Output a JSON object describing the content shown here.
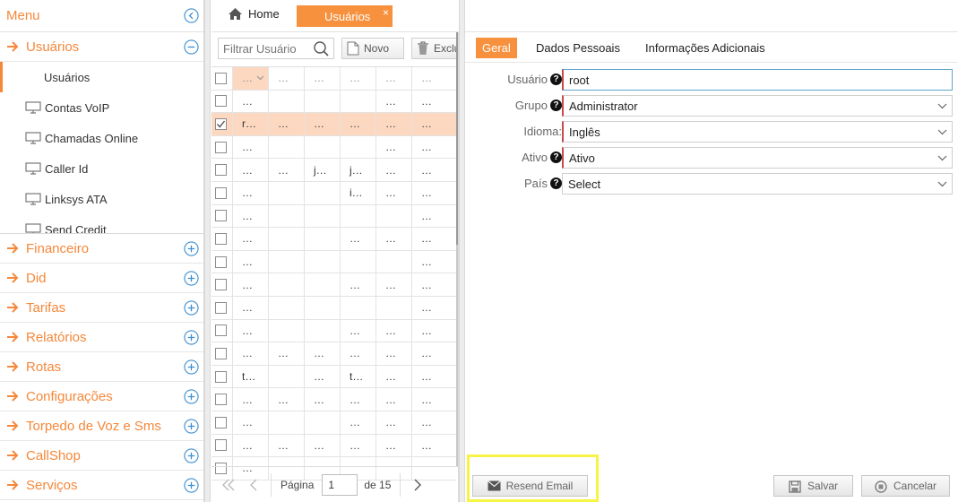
{
  "sidebar": {
    "title": "Menu",
    "sections": [
      {
        "label": "Usuários",
        "expanded": true
      },
      {
        "label": "Financeiro"
      },
      {
        "label": "Did"
      },
      {
        "label": "Tarifas"
      },
      {
        "label": "Relatórios"
      },
      {
        "label": "Rotas"
      },
      {
        "label": "Configurações"
      },
      {
        "label": "Torpedo de Voz e Sms"
      },
      {
        "label": "CallShop"
      },
      {
        "label": "Serviços"
      }
    ],
    "sub_items": [
      {
        "label": "Usuários",
        "active": true
      },
      {
        "label": "Contas VoIP"
      },
      {
        "label": "Chamadas Online"
      },
      {
        "label": "Caller Id"
      },
      {
        "label": "Linksys ATA"
      },
      {
        "label": "Send Credit"
      }
    ]
  },
  "tabs": {
    "home": "Home",
    "active": "Usuários",
    "close": "×"
  },
  "grid": {
    "filter_placeholder": "Filtrar Usuário",
    "new_label": "Novo",
    "delete_label": "Excluir",
    "header": [
      "…",
      "…",
      "…",
      "…",
      "…",
      "…"
    ],
    "rows": [
      {
        "checked": false,
        "cells": [
          "…",
          "",
          "",
          "",
          "…",
          "…"
        ]
      },
      {
        "checked": true,
        "cells": [
          "r…",
          "…",
          "…",
          "…",
          "…",
          "…"
        ]
      },
      {
        "checked": false,
        "cells": [
          "…",
          "",
          "",
          "",
          "…",
          "…"
        ]
      },
      {
        "checked": false,
        "cells": [
          "…",
          "…",
          "j…",
          "j…",
          "…",
          "…"
        ]
      },
      {
        "checked": false,
        "cells": [
          "…",
          "",
          "",
          "i…",
          "…",
          "…"
        ]
      },
      {
        "checked": false,
        "cells": [
          "…",
          "",
          "",
          "",
          "",
          "…"
        ]
      },
      {
        "checked": false,
        "cells": [
          "…",
          "",
          "",
          "…",
          "…",
          "…"
        ]
      },
      {
        "checked": false,
        "cells": [
          "…",
          "",
          "",
          "",
          "",
          "…"
        ]
      },
      {
        "checked": false,
        "cells": [
          "…",
          "",
          "",
          "…",
          "…",
          "…"
        ]
      },
      {
        "checked": false,
        "cells": [
          "…",
          "",
          "",
          "",
          "",
          "…"
        ]
      },
      {
        "checked": false,
        "cells": [
          "…",
          "",
          "",
          "…",
          "…",
          "…"
        ]
      },
      {
        "checked": false,
        "cells": [
          "…",
          "…",
          "…",
          "…",
          "…",
          "…"
        ]
      },
      {
        "checked": false,
        "cells": [
          "t…",
          "",
          "…",
          "t…",
          "…",
          "…"
        ]
      },
      {
        "checked": false,
        "cells": [
          "…",
          "…",
          "…",
          "…",
          "…",
          "…"
        ]
      },
      {
        "checked": false,
        "cells": [
          "…",
          "",
          "",
          "…",
          "…",
          "…"
        ]
      },
      {
        "checked": false,
        "cells": [
          "…",
          "…",
          "…",
          "…",
          "…",
          "…"
        ]
      },
      {
        "checked": false,
        "cells": [
          "…",
          "",
          "",
          "",
          "",
          ""
        ]
      }
    ],
    "pager": {
      "page_label": "Página",
      "page": "1",
      "of_label": "de 15"
    }
  },
  "form": {
    "tabs": [
      "Geral",
      "Dados Pessoais",
      "Informações Adicionais"
    ],
    "fields": [
      {
        "label": "Usuário",
        "value": "root",
        "help": true
      },
      {
        "label": "Grupo",
        "value": "Administrator",
        "help": true
      },
      {
        "label": "Idioma:",
        "value": "Inglês",
        "help": false
      },
      {
        "label": "Ativo",
        "value": "Ativo",
        "help": true
      },
      {
        "label": "País",
        "value": "Select",
        "help": true
      }
    ],
    "resend_label": "Resend Email",
    "save_label": "Salvar",
    "cancel_label": "Cancelar"
  },
  "colors": {
    "accent": "#f7913e",
    "highlight": "#f7f445",
    "selected_row": "#fcd8c1"
  }
}
